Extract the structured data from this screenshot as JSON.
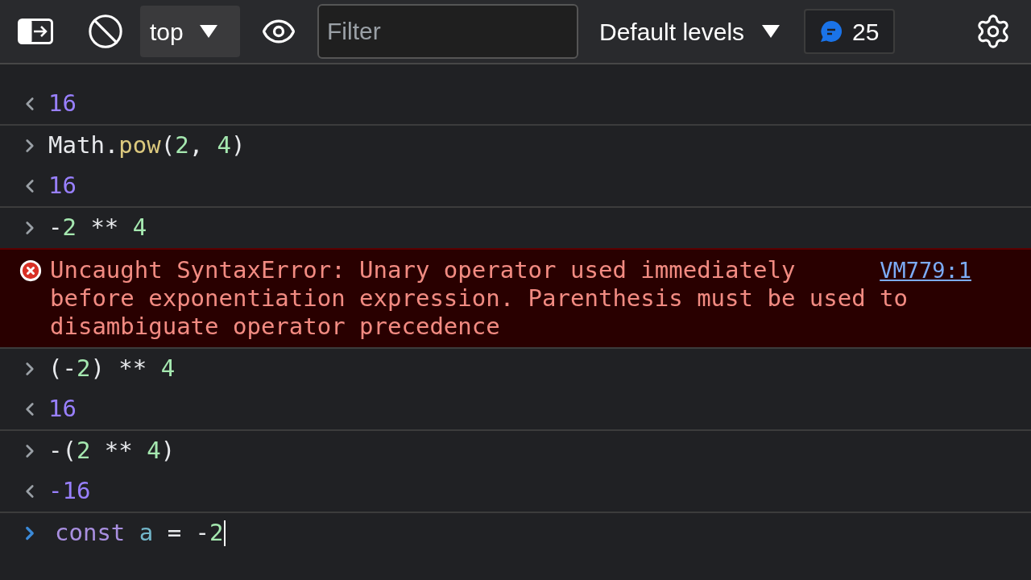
{
  "toolbar": {
    "context": "top",
    "filter": {
      "placeholder": "Filter"
    },
    "levels": "Default levels",
    "issues_count": "25"
  },
  "entries": [
    {
      "output": "16"
    },
    {
      "input": [
        {
          "text": "Math.",
          "kind": "plain"
        },
        {
          "text": "pow",
          "kind": "method"
        },
        {
          "text": "(",
          "kind": "plain"
        },
        {
          "text": "2",
          "kind": "number"
        },
        {
          "text": ", ",
          "kind": "plain"
        },
        {
          "text": "4",
          "kind": "number"
        },
        {
          "text": ")",
          "kind": "plain"
        }
      ],
      "output": "16"
    },
    {
      "input": [
        {
          "text": "-",
          "kind": "plain"
        },
        {
          "text": "2",
          "kind": "number"
        },
        {
          "text": " ** ",
          "kind": "plain"
        },
        {
          "text": "4",
          "kind": "number"
        }
      ],
      "error": {
        "message_lines": [
          "Uncaught SyntaxError: Unary operator used immediately",
          "before exponentiation expression. Parenthesis must be used to",
          "disambiguate operator precedence"
        ],
        "source": "VM779:1"
      }
    },
    {
      "input": [
        {
          "text": "(-",
          "kind": "plain"
        },
        {
          "text": "2",
          "kind": "number"
        },
        {
          "text": ") ** ",
          "kind": "plain"
        },
        {
          "text": "4",
          "kind": "number"
        }
      ],
      "output": "16"
    },
    {
      "input": [
        {
          "text": "-(",
          "kind": "plain"
        },
        {
          "text": "2",
          "kind": "number"
        },
        {
          "text": " ** ",
          "kind": "plain"
        },
        {
          "text": "4",
          "kind": "number"
        },
        {
          "text": ")",
          "kind": "plain"
        }
      ],
      "output": "-16"
    }
  ],
  "prompt": [
    {
      "text": "const",
      "kind": "keyword"
    },
    {
      "text": " a",
      "kind": "variable"
    },
    {
      "text": " = -",
      "kind": "plain"
    },
    {
      "text": "2",
      "kind": "number"
    }
  ]
}
